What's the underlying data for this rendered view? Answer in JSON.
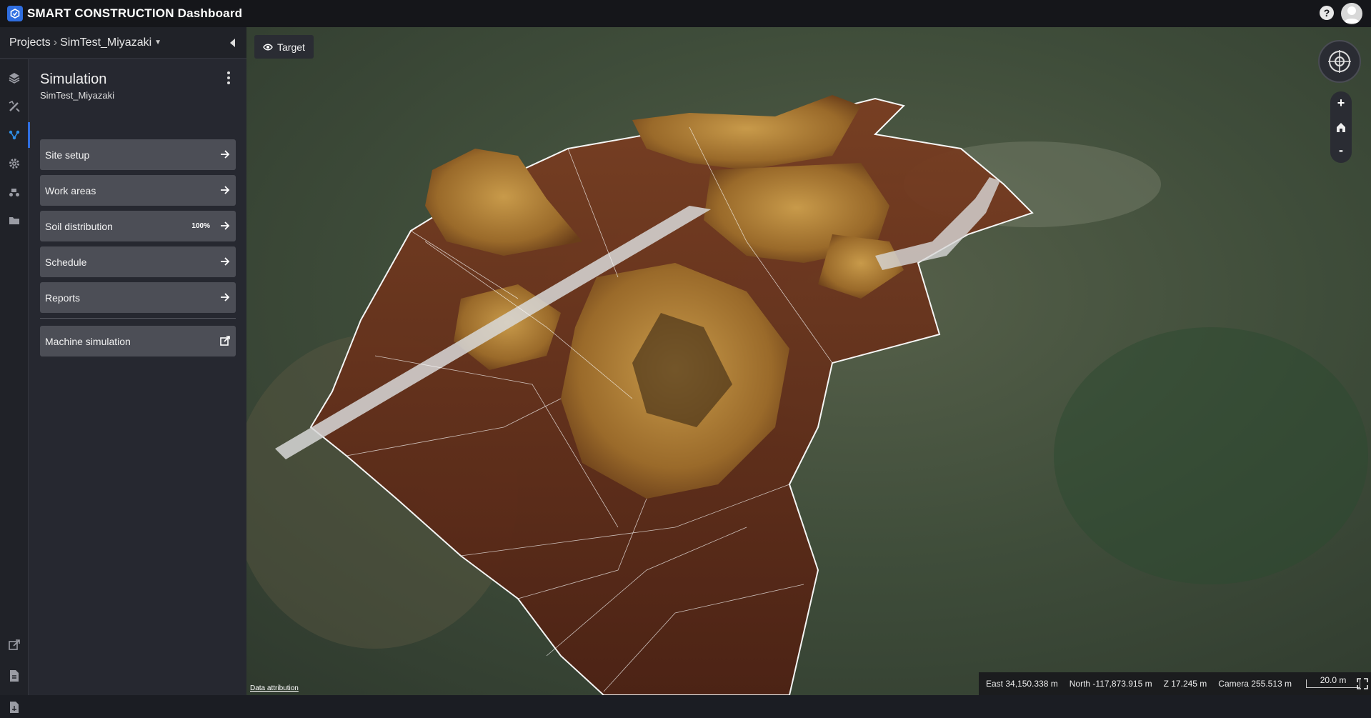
{
  "app": {
    "title": "SMART CONSTRUCTION Dashboard"
  },
  "breadcrumb": {
    "root": "Projects",
    "separator": "›",
    "project": "SimTest_Miyazaki"
  },
  "panel": {
    "title": "Simulation",
    "subtitle": "SimTest_Miyazaki",
    "menu": [
      {
        "label": "Site setup",
        "badge": "",
        "icon": "arrow-right-icon"
      },
      {
        "label": "Work areas",
        "badge": "",
        "icon": "arrow-right-icon"
      },
      {
        "label": "Soil distribution",
        "badge": "100%",
        "icon": "arrow-right-icon"
      },
      {
        "label": "Schedule",
        "badge": "",
        "icon": "arrow-right-icon"
      },
      {
        "label": "Reports",
        "badge": "",
        "icon": "arrow-right-icon"
      }
    ],
    "external_item": {
      "label": "Machine simulation",
      "icon": "external-link-icon"
    }
  },
  "rail": [
    "layers-icon",
    "design-tools-icon",
    "simulation-icon",
    "settings-icon",
    "machine-icon",
    "folder-icon"
  ],
  "rail_bottom": [
    "export-icon",
    "document-icon",
    "report-icon"
  ],
  "map": {
    "target_label": "Target",
    "attribution": "Data attribution",
    "zoom_in": "+",
    "zoom_out": "-",
    "status": {
      "east": "East 34,150.338 m",
      "north": "North -117,873.915 m",
      "z": "Z 17.245 m",
      "camera": "Camera 255.513 m",
      "scale": "20.0 m"
    }
  },
  "colors": {
    "accent": "#2f6ee0",
    "panel": "#262830",
    "button": "#4c4e56",
    "topbar": "#15161a"
  }
}
